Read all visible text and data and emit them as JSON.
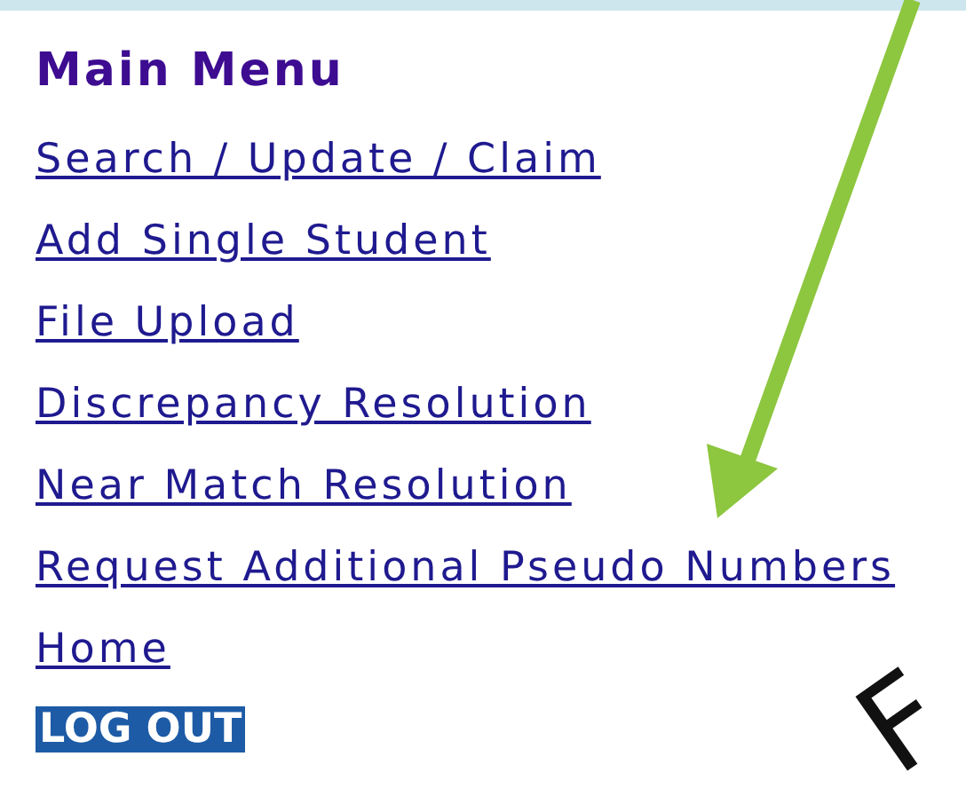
{
  "menu": {
    "title": "Main Menu",
    "links": [
      {
        "label": "Search / Update / Claim"
      },
      {
        "label": "Add Single Student"
      },
      {
        "label": "File Upload"
      },
      {
        "label": "Discrepancy Resolution"
      },
      {
        "label": "Near Match Resolution"
      },
      {
        "label": "Request Additional Pseudo Numbers"
      },
      {
        "label": "Home"
      }
    ],
    "logout_button": "LOG OUT"
  },
  "annotation": {
    "text": "F"
  }
}
